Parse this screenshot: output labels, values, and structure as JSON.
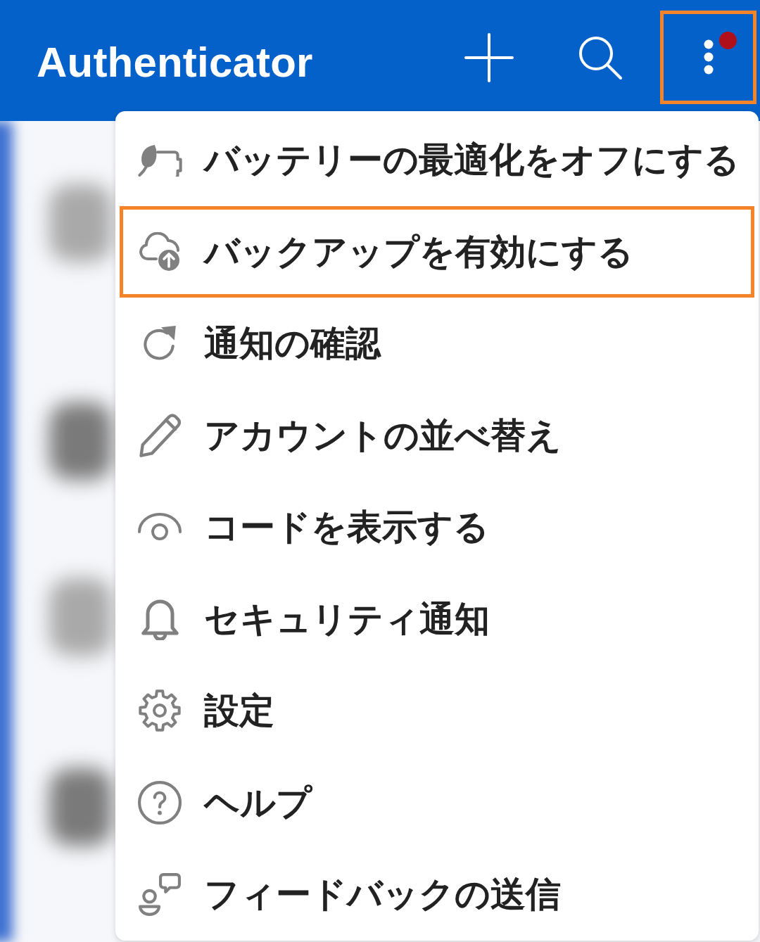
{
  "app_bar": {
    "title": "Authenticator",
    "actions": [
      {
        "kind": "add",
        "highlighted": false,
        "badge": false
      },
      {
        "kind": "search",
        "highlighted": false,
        "badge": false
      },
      {
        "kind": "more",
        "highlighted": true,
        "badge": true
      }
    ]
  },
  "menu": {
    "items": [
      {
        "kind": "battery",
        "label": "バッテリーの最適化をオフにする",
        "highlighted": false
      },
      {
        "kind": "cloud_upload",
        "label": "バックアップを有効にする",
        "highlighted": true
      },
      {
        "kind": "refresh",
        "label": "通知の確認",
        "highlighted": false
      },
      {
        "kind": "pencil",
        "label": "アカウントの並べ替え",
        "highlighted": false
      },
      {
        "kind": "eye",
        "label": "コードを表示する",
        "highlighted": false
      },
      {
        "kind": "bell",
        "label": "セキュリティ通知",
        "highlighted": false
      },
      {
        "kind": "gear",
        "label": "設定",
        "highlighted": false
      },
      {
        "kind": "help",
        "label": "ヘルプ",
        "highlighted": false
      },
      {
        "kind": "feedback",
        "label": "フィードバックの送信",
        "highlighted": false
      }
    ]
  }
}
